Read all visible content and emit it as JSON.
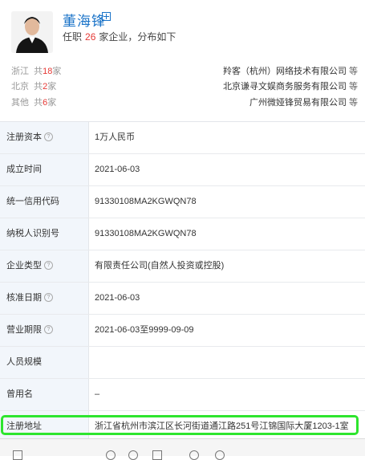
{
  "person": {
    "name": "董海锋",
    "tenure_prefix": "任职",
    "company_count": "26",
    "tenure_suffix": "家企业，分布如下"
  },
  "regions": [
    {
      "name": "浙江",
      "prefix": "共",
      "count": "18",
      "unit": "家",
      "company": "羚客（杭州）网络技术有限公司",
      "etc": "等"
    },
    {
      "name": "北京",
      "prefix": "共",
      "count": "2",
      "unit": "家",
      "company": "北京谦寻文娱商务服务有限公司",
      "etc": "等"
    },
    {
      "name": "其他",
      "prefix": "共",
      "count": "6",
      "unit": "家",
      "company": "广州微娅锋贸易有限公司",
      "etc": "等"
    }
  ],
  "details": [
    {
      "label": "注册资本",
      "info": true,
      "value": "1万人民币"
    },
    {
      "label": "成立时间",
      "info": false,
      "value": "2021-06-03"
    },
    {
      "label": "统一信用代码",
      "info": false,
      "value": "91330108MA2KGWQN78"
    },
    {
      "label": "纳税人识别号",
      "info": false,
      "value": "91330108MA2KGWQN78"
    },
    {
      "label": "企业类型",
      "info": true,
      "value": "有限责任公司(自然人投资或控股)"
    },
    {
      "label": "核准日期",
      "info": true,
      "value": "2021-06-03"
    },
    {
      "label": "营业期限",
      "info": true,
      "value": "2021-06-03至9999-09-09"
    },
    {
      "label": "人员规模",
      "info": false,
      "value": ""
    },
    {
      "label": "曾用名",
      "info": false,
      "value": "–"
    },
    {
      "label": "注册地址",
      "info": false,
      "value": "浙江省杭州市滨江区长河街道通江路251号江锦国际大厦1203-1室"
    }
  ],
  "colors": {
    "link": "#1a73c8",
    "count": "#e53935",
    "label_bg": "#f2f6fb",
    "highlight": "#2ee52e"
  },
  "icons": {
    "expand": "plus-square-icon",
    "info": "question-circle-icon"
  }
}
